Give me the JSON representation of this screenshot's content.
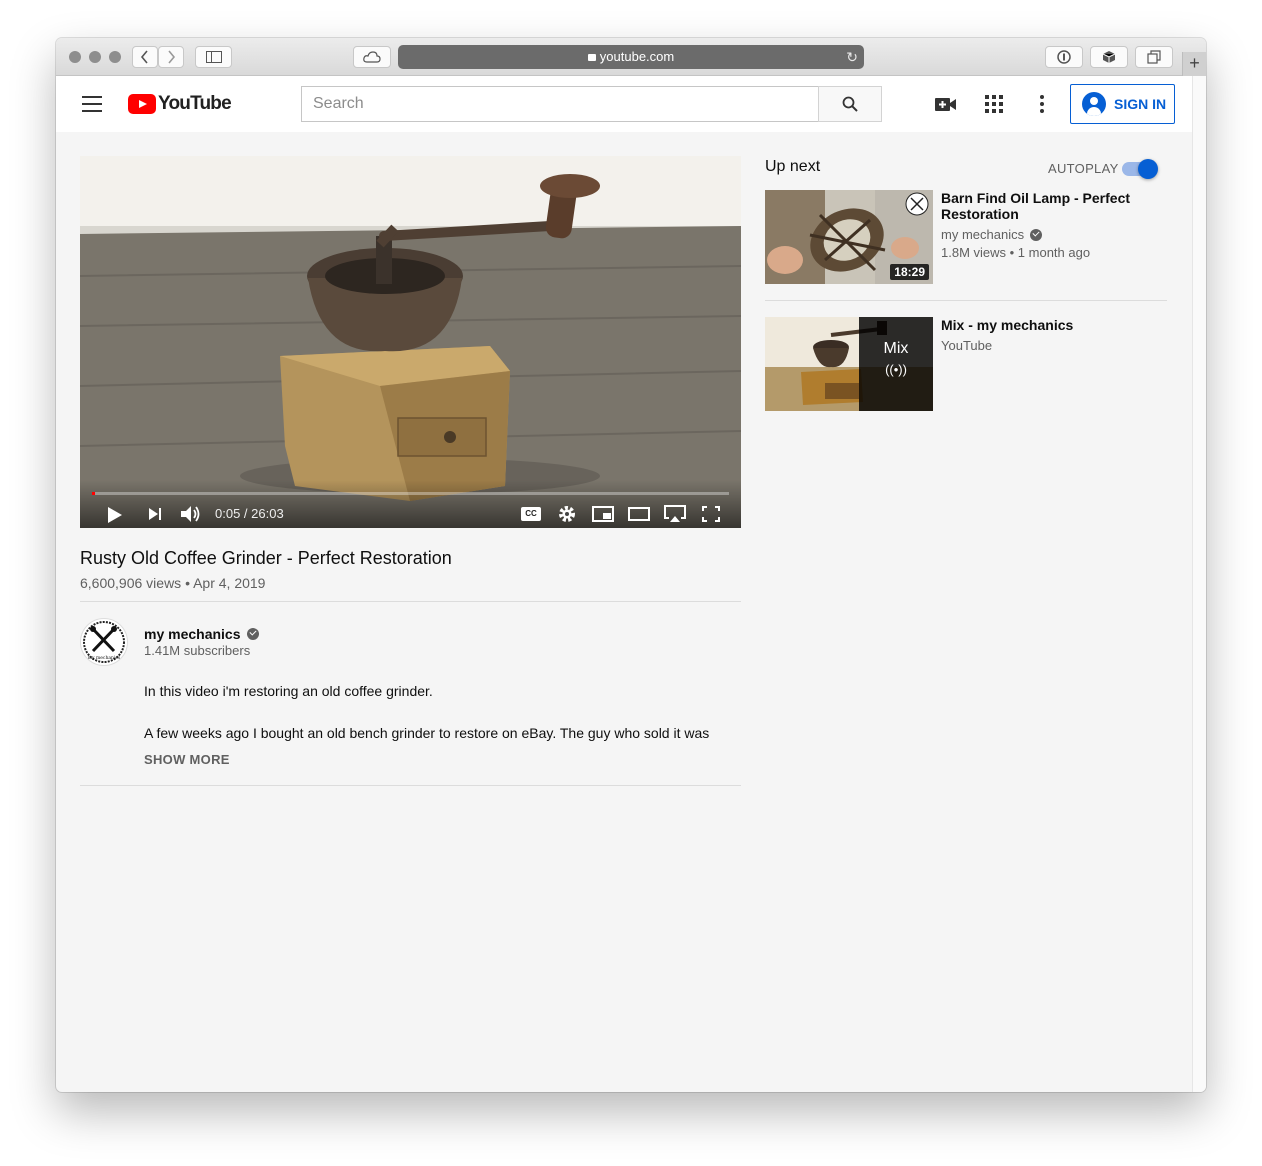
{
  "browser": {
    "url": "youtube.com"
  },
  "header": {
    "logo_text": "YouTube",
    "search_placeholder": "Search",
    "signin_label": "SIGN IN"
  },
  "player": {
    "time_display": "0:05 / 26:03",
    "progress_fraction": 0.005,
    "cc_label": "CC"
  },
  "video": {
    "title": "Rusty Old Coffee Grinder - Perfect Restoration",
    "meta": "6,600,906 views • Apr 4, 2019",
    "channel_name": "my mechanics",
    "avatar_text": "my mechanics",
    "subscribers": "1.41M subscribers",
    "description_line1": "In this video i'm restoring an old coffee grinder.",
    "description_line2": "A few weeks ago I bought an old bench grinder to restore on eBay. The guy who sold it was",
    "show_more": "SHOW MORE"
  },
  "sidebar": {
    "up_next_label": "Up next",
    "autoplay_label": "AUTOPLAY",
    "autoplay_on": true,
    "items": [
      {
        "title": "Barn Find Oil Lamp - Perfect Restoration",
        "channel": "my mechanics",
        "meta": "1.8M views • 1 month ago",
        "duration": "18:29"
      },
      {
        "title": "Mix - my mechanics",
        "channel": "YouTube",
        "overlay_label": "Mix",
        "overlay_icon": "((•))"
      }
    ]
  },
  "colors": {
    "accent": "#065fd4",
    "brand_red": "#ff0000"
  }
}
